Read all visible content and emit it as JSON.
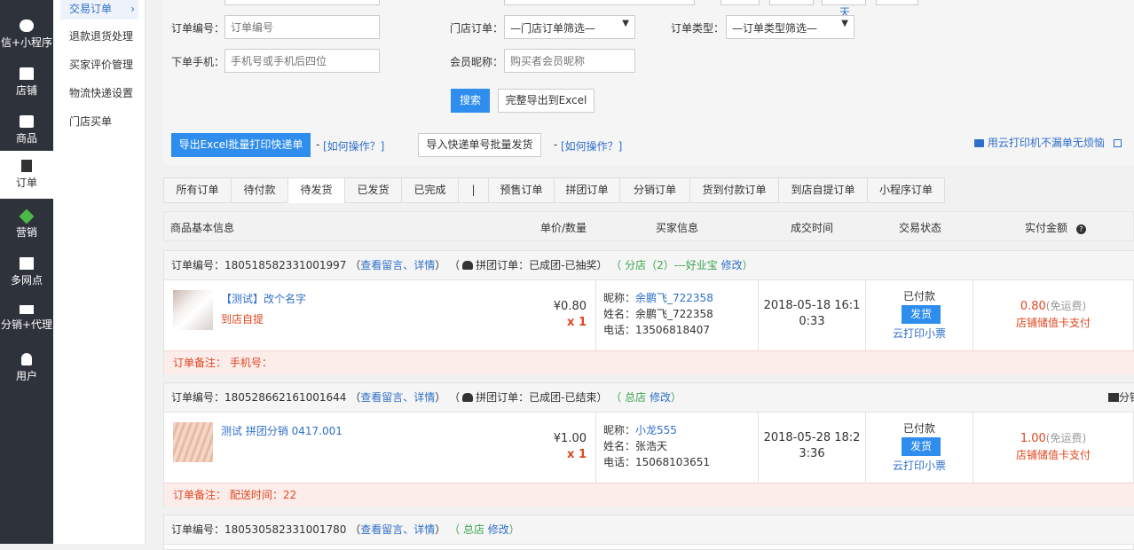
{
  "nav": {
    "items": [
      {
        "label": "信+小程序",
        "icon": "wechat-icon"
      },
      {
        "label": "店铺",
        "icon": "store-icon"
      },
      {
        "label": "商品",
        "icon": "bag-icon"
      },
      {
        "label": "订单",
        "icon": "order-icon"
      },
      {
        "label": "营销",
        "icon": "cube-icon"
      },
      {
        "label": "多网点",
        "icon": "shop-icon"
      },
      {
        "label": "分销+代理",
        "icon": "network-icon"
      },
      {
        "label": "用户",
        "icon": "user-icon"
      }
    ]
  },
  "subnav": {
    "items": [
      "交易订单",
      "退款退货处理",
      "买家评价管理",
      "物流快递设置",
      "门店买单"
    ]
  },
  "filter": {
    "top_fragment": "天",
    "order_no_label": "订单编号：",
    "order_no_placeholder": "订单编号",
    "store_order_label": "门店订单：",
    "store_order_value": "—门店订单筛选—",
    "order_type_label": "订单类型：",
    "order_type_value": "—订单类型筛选—",
    "phone_label": "下单手机：",
    "phone_placeholder": "手机号或手机后四位",
    "nickname_label": "会员昵称：",
    "nickname_placeholder": "购买者会员昵称",
    "search_label": "搜索",
    "export_label": "完整导出到Excel"
  },
  "actions": {
    "export_batch_label": "导出Excel批量打印快递单",
    "dash": "-",
    "howto_1": "[如何操作？]",
    "import_label": "导入快递单号批量发货",
    "howto_2": "[如何操作？]",
    "cloud_print": "用云打印机不漏单无烦恼"
  },
  "tabs": [
    "所有订单",
    "待付款",
    "待发货",
    "已发货",
    "已完成",
    "|",
    "预售订单",
    "拼团订单",
    "分销订单",
    "货到付款订单",
    "到店自提订单",
    "小程序订单"
  ],
  "table_header": {
    "product": "商品基本信息",
    "price_qty": "单价/数量",
    "buyer": "买家信息",
    "time": "成交时间",
    "status": "交易状态",
    "amount": "实付金额"
  },
  "orders": [
    {
      "head": {
        "no_label": "订单编号：",
        "no": "180518582331001997",
        "view": "查看留言、详情",
        "group": "拼团订单：已成团-已抽奖",
        "store": "（ 分店（2）---好业宝",
        "modify": "修改",
        "extra": ""
      },
      "product_name": "【测试】改个名字",
      "product_note": "到店自提",
      "price": "¥0.80",
      "qty": "x 1",
      "buyer_nick_label": "昵称：",
      "buyer_nick": "余鹏飞_722358",
      "buyer_name": "姓名：余鹏飞_722358",
      "buyer_phone": "电话：13506818407",
      "time_a": "2018-05-18 16:1",
      "time_b": "0:33",
      "status": "已付款",
      "ship": "发货",
      "print": "云打印小票",
      "amount": "0.80",
      "amount_note": "(免运费)",
      "pay": "店铺储值卡支付",
      "note": "订单备注： 手机号："
    },
    {
      "head": {
        "no_label": "订单编号：",
        "no": "180528662161001644",
        "view": "查看留言、详情",
        "group": "拼团订单：已成团-已结束",
        "store": "（ 总店",
        "modify": "修改",
        "extra": "分销"
      },
      "product_name": "测试 拼团分销 0417.001",
      "product_note": "",
      "price": "¥1.00",
      "qty": "x 1",
      "buyer_nick_label": "昵称：",
      "buyer_nick": "小龙555",
      "buyer_name": "姓名：张浩天",
      "buyer_phone": "电话：15068103651",
      "time_a": "2018-05-28 18:2",
      "time_b": "3:36",
      "status": "已付款",
      "ship": "发货",
      "print": "云打印小票",
      "amount": "1.00",
      "amount_note": "(免运费)",
      "pay": "店铺储值卡支付",
      "note": "订单备注： 配送时间：22"
    },
    {
      "head": {
        "no_label": "订单编号：",
        "no": "180530582331001780",
        "view": "查看留言、详情",
        "group": "",
        "store": "（ 总店",
        "modify": "修改",
        "extra": ""
      }
    }
  ],
  "colors": {
    "accent": "#2e8ded",
    "link": "#2f6fc9",
    "red": "#e0471f",
    "green": "#3aa54e",
    "nav_bg": "#2e323b"
  }
}
